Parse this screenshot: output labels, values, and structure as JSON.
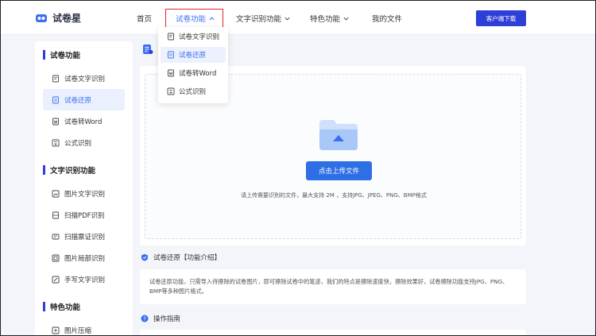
{
  "header": {
    "logo_text": "试卷星",
    "nav": [
      {
        "label": "首页"
      },
      {
        "label": "试卷功能"
      },
      {
        "label": "文字识别功能"
      },
      {
        "label": "特色功能"
      },
      {
        "label": "我的文件"
      }
    ],
    "download_label": "客户端下载"
  },
  "dropdown": {
    "items": [
      {
        "label": "试卷文字识别",
        "icon": "doc-text-icon"
      },
      {
        "label": "试卷还原",
        "icon": "doc-restore-icon"
      },
      {
        "label": "试卷转Word",
        "icon": "doc-word-icon"
      },
      {
        "label": "公式识别",
        "icon": "formula-icon"
      }
    ],
    "selected": "试卷还原"
  },
  "sidebar": {
    "sections": [
      {
        "title": "试卷功能",
        "items": [
          {
            "label": "试卷文字识别",
            "icon": "doc-text-icon"
          },
          {
            "label": "试卷还原",
            "icon": "doc-restore-icon"
          },
          {
            "label": "试卷转Word",
            "icon": "doc-word-icon"
          },
          {
            "label": "公式识别",
            "icon": "formula-icon"
          }
        ]
      },
      {
        "title": "文字识别功能",
        "items": [
          {
            "label": "图片文字识别",
            "icon": "image-text-icon"
          },
          {
            "label": "扫描PDF识别",
            "icon": "pdf-scan-icon"
          },
          {
            "label": "扫描票证识别",
            "icon": "ticket-scan-icon"
          },
          {
            "label": "图片局部识别",
            "icon": "image-crop-icon"
          },
          {
            "label": "手写文字识别",
            "icon": "handwriting-icon"
          }
        ]
      },
      {
        "title": "特色功能",
        "items": [
          {
            "label": "图片压缩",
            "icon": "image-compress-icon"
          }
        ]
      }
    ],
    "active": "试卷还原"
  },
  "upload": {
    "button_label": "点击上传文件",
    "hint": "请上传需要识别的文件，最大支持 2M ，支持JPG、JPEG、PNG、BMP格式"
  },
  "intro": {
    "title": "试卷还原【功能介绍】",
    "text": "试卷还原功能，只需导入待擦除的试卷图片，即可擦除试卷中的笔迹，我们的特点是擦除速度快，擦除效果好，试卷擦除功能支持JPG、PNG、BMP等多种图片格式。"
  },
  "guide": {
    "title": "操作指南"
  },
  "colors": {
    "accent": "#3b6ff0",
    "brand": "#2e3fd8",
    "highlight_box": "#e0242b"
  }
}
